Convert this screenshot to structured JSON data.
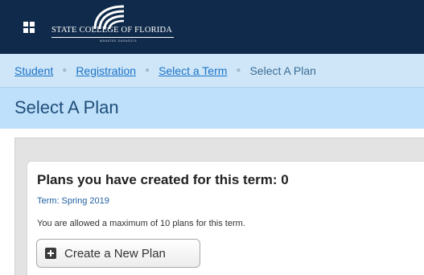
{
  "header": {
    "logo_text": "STATE COLLEGE OF FLORIDA",
    "logo_subtext": "MANATEE-SARASOTA"
  },
  "breadcrumb": {
    "items": [
      {
        "label": "Student"
      },
      {
        "label": "Registration"
      },
      {
        "label": "Select a Term"
      }
    ],
    "current": "Select A Plan",
    "separator": "●"
  },
  "page": {
    "title": "Select A Plan"
  },
  "plans": {
    "heading": "Plans you have created for this term: 0",
    "term": "Term: Spring 2019",
    "limit_text": "You are allowed a maximum of 10 plans for this term.",
    "create_button_label": "Create a New Plan"
  },
  "colors": {
    "header_bg": "#0f2a4a",
    "breadcrumb_bg": "#cfe6f8",
    "title_bg": "#bfe0fb",
    "link": "#1a73c7",
    "title_text": "#1f4e79"
  },
  "icons": {
    "menu": "grid-menu-icon",
    "create": "plus-square-icon"
  }
}
